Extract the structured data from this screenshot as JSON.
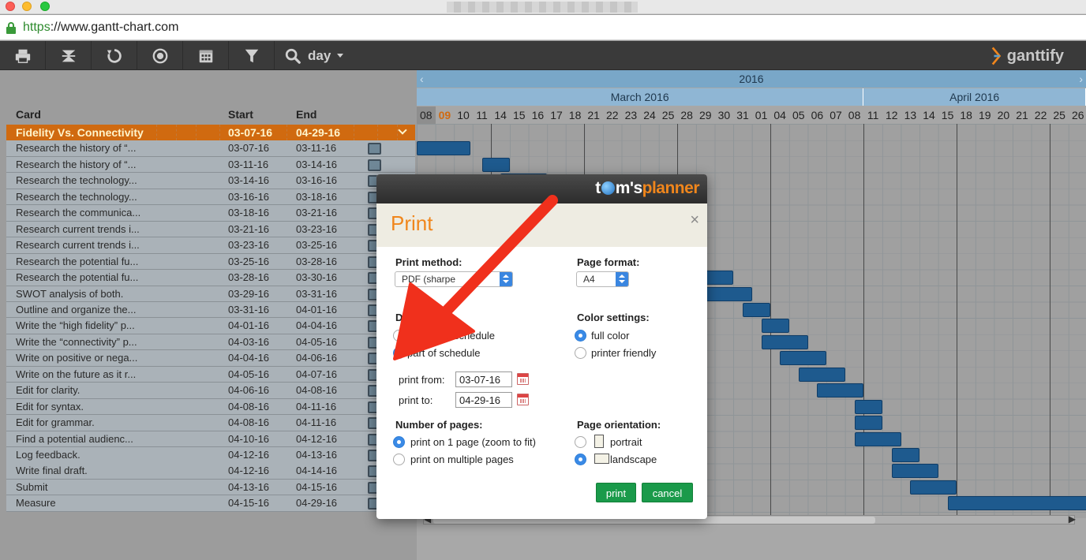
{
  "browser": {
    "url_scheme": "https",
    "url_rest": "://www.gantt-chart.com"
  },
  "toolbar": {
    "buttons": [
      {
        "icon": "print-icon"
      },
      {
        "icon": "collapse-icon"
      },
      {
        "icon": "refresh-icon"
      },
      {
        "icon": "target-icon"
      },
      {
        "icon": "calendar-icon"
      },
      {
        "icon": "filter-icon"
      }
    ],
    "zoom_label": "day",
    "logo_text": "ganttify"
  },
  "tasklist": {
    "headers": {
      "card": "Card",
      "start": "Start",
      "end": "End"
    },
    "project": {
      "name": "Fidelity Vs. Connectivity",
      "start": "03-07-16",
      "end": "04-29-16"
    },
    "rows": [
      {
        "name": "Research the history of “...",
        "start": "03-07-16",
        "end": "03-11-16"
      },
      {
        "name": "Research the history of “...",
        "start": "03-11-16",
        "end": "03-14-16"
      },
      {
        "name": "Research the technology...",
        "start": "03-14-16",
        "end": "03-16-16"
      },
      {
        "name": "Research the technology...",
        "start": "03-16-16",
        "end": "03-18-16"
      },
      {
        "name": "Research the communica...",
        "start": "03-18-16",
        "end": "03-21-16"
      },
      {
        "name": "Research current trends i...",
        "start": "03-21-16",
        "end": "03-23-16"
      },
      {
        "name": "Research current trends i...",
        "start": "03-23-16",
        "end": "03-25-16"
      },
      {
        "name": "Research the potential fu...",
        "start": "03-25-16",
        "end": "03-28-16"
      },
      {
        "name": "Research the potential fu...",
        "start": "03-28-16",
        "end": "03-30-16"
      },
      {
        "name": "SWOT analysis of both.",
        "start": "03-29-16",
        "end": "03-31-16"
      },
      {
        "name": "Outline and organize the...",
        "start": "03-31-16",
        "end": "04-01-16"
      },
      {
        "name": "Write the “high fidelity” p...",
        "start": "04-01-16",
        "end": "04-04-16"
      },
      {
        "name": "Write the “connectivity” p...",
        "start": "04-03-16",
        "end": "04-05-16"
      },
      {
        "name": "Write on positive or nega...",
        "start": "04-04-16",
        "end": "04-06-16"
      },
      {
        "name": "Write on the future as it r...",
        "start": "04-05-16",
        "end": "04-07-16"
      },
      {
        "name": "Edit for clarity.",
        "start": "04-06-16",
        "end": "04-08-16"
      },
      {
        "name": "Edit for syntax.",
        "start": "04-08-16",
        "end": "04-11-16"
      },
      {
        "name": "Edit for grammar.",
        "start": "04-08-16",
        "end": "04-11-16"
      },
      {
        "name": "Find a potential audienc...",
        "start": "04-10-16",
        "end": "04-12-16"
      },
      {
        "name": "Log feedback.",
        "start": "04-12-16",
        "end": "04-13-16"
      },
      {
        "name": "Write final draft.",
        "start": "04-12-16",
        "end": "04-14-16"
      },
      {
        "name": "Submit",
        "start": "04-13-16",
        "end": "04-15-16"
      },
      {
        "name": "Measure",
        "start": "04-15-16",
        "end": "04-29-16"
      }
    ]
  },
  "timeline": {
    "year": "2016",
    "months": [
      {
        "label": "March 2016",
        "days": 24
      },
      {
        "label": "April 2016",
        "days": 12
      }
    ],
    "days": [
      "08",
      "09",
      "10",
      "11",
      "14",
      "15",
      "16",
      "17",
      "18",
      "21",
      "22",
      "23",
      "24",
      "25",
      "28",
      "29",
      "30",
      "31",
      "01",
      "04",
      "05",
      "06",
      "07",
      "08",
      "11",
      "12",
      "13",
      "14",
      "15",
      "18",
      "19",
      "20",
      "21",
      "22",
      "25",
      "26"
    ],
    "today_index": 1,
    "week_starts": [
      4,
      9,
      14,
      19,
      24,
      29,
      34
    ]
  },
  "dialog": {
    "brand_a": "t",
    "brand_b": "m's",
    "brand_c": "planner",
    "title": "Print",
    "close": "×",
    "print_method_label": "Print method:",
    "print_method_value": "PDF (sharpe",
    "page_format_label": "Page format:",
    "page_format_value": "A4",
    "date_range_label": "Dat",
    "option_entire": "schedule",
    "option_part": "part of schedule",
    "color_label": "Color settings:",
    "color_full": "full color",
    "color_printer": "printer friendly",
    "print_from_label": "print from:",
    "print_from_value": "03-07-16",
    "print_to_label": "print to:",
    "print_to_value": "04-29-16",
    "pages_label": "Number of pages:",
    "pages_one": "print on 1 page (zoom to fit)",
    "pages_multi": "print on multiple pages",
    "orientation_label": "Page orientation:",
    "orientation_portrait": "portrait",
    "orientation_landscape": "landscape",
    "print_button": "print",
    "cancel_button": "cancel"
  },
  "colors": {
    "accent_orange": "#f0861c",
    "bar_blue": "#1e5a8e",
    "button_green": "#1a9a4a",
    "annotation_red": "#f0301c"
  }
}
